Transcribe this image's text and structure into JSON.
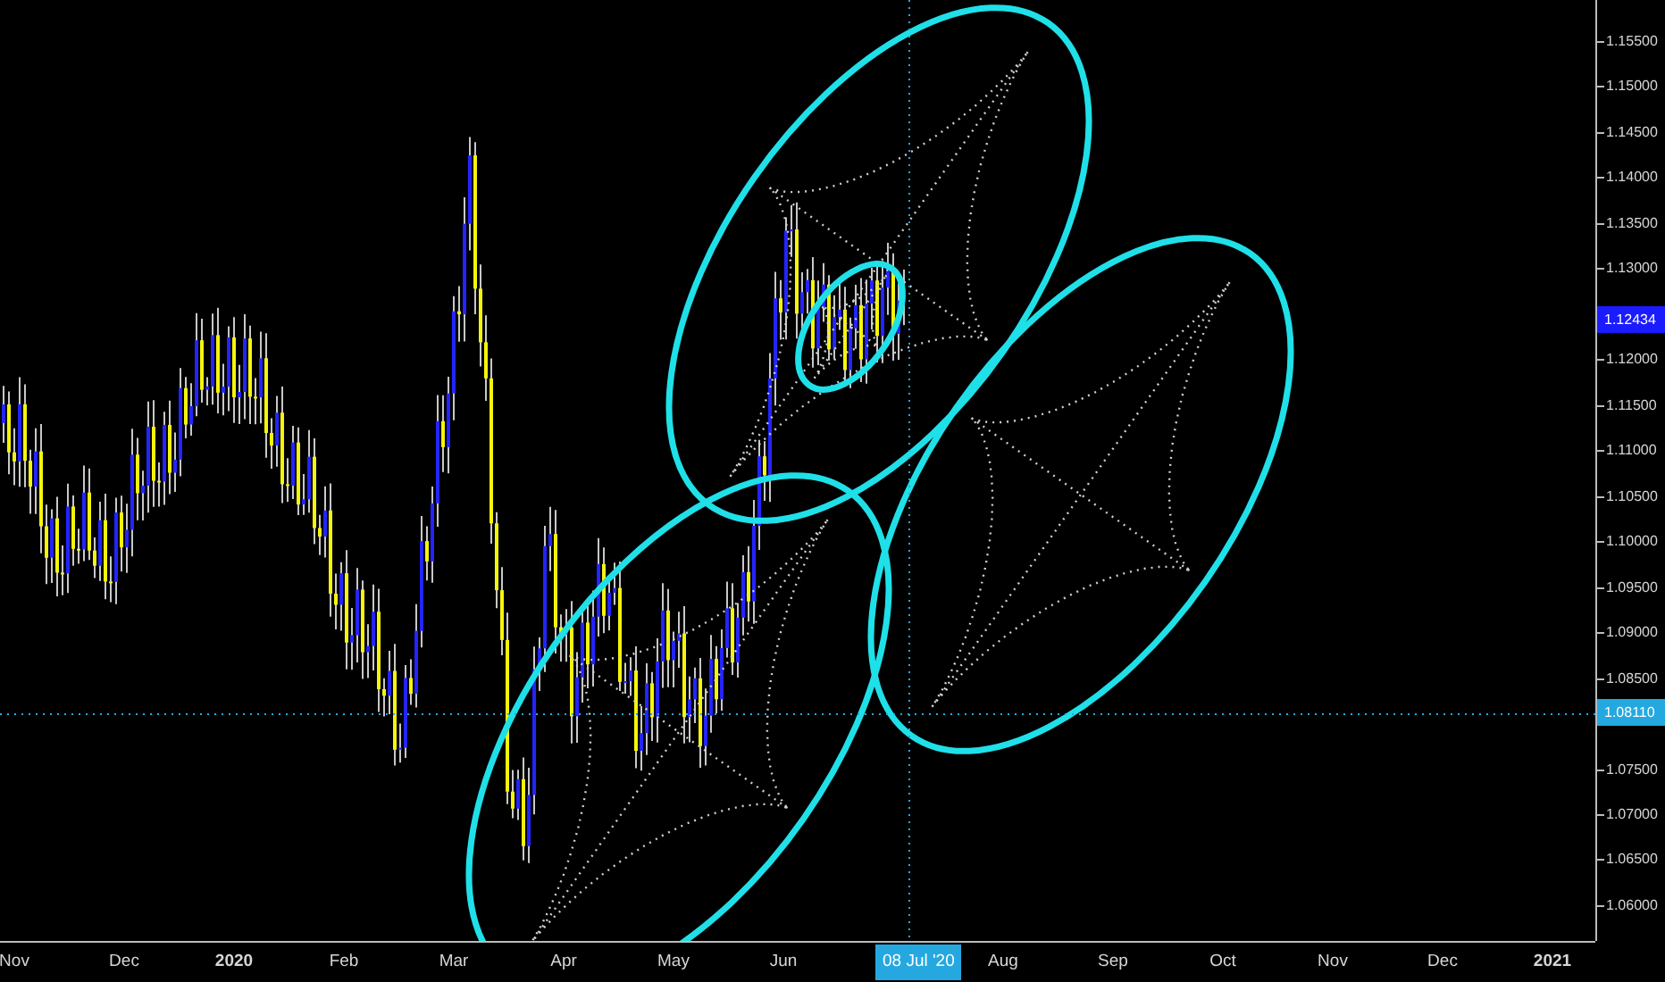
{
  "price_axis": {
    "labels": [
      "1.15500",
      "1.15000",
      "1.14500",
      "1.14000",
      "1.13500",
      "1.13000",
      "1.12000",
      "1.11500",
      "1.11000",
      "1.10500",
      "1.10000",
      "1.09500",
      "1.09000",
      "1.08500",
      "1.07500",
      "1.07000",
      "1.06500",
      "1.06000"
    ]
  },
  "time_axis": {
    "labels": [
      {
        "text": "Nov",
        "kind": "month"
      },
      {
        "text": "Dec",
        "kind": "month"
      },
      {
        "text": "2020",
        "kind": "year"
      },
      {
        "text": "Feb",
        "kind": "month"
      },
      {
        "text": "Mar",
        "kind": "month"
      },
      {
        "text": "Apr",
        "kind": "month"
      },
      {
        "text": "May",
        "kind": "month"
      },
      {
        "text": "Jun",
        "kind": "month"
      },
      {
        "text": "Aug",
        "kind": "month"
      },
      {
        "text": "Sep",
        "kind": "month"
      },
      {
        "text": "Oct",
        "kind": "month"
      },
      {
        "text": "Nov",
        "kind": "month"
      },
      {
        "text": "Dec",
        "kind": "month"
      },
      {
        "text": "2021",
        "kind": "year"
      }
    ]
  },
  "last_price_tag": "1.12434",
  "crosshair": {
    "price": "1.08110",
    "date": "08 Jul '20"
  }
}
